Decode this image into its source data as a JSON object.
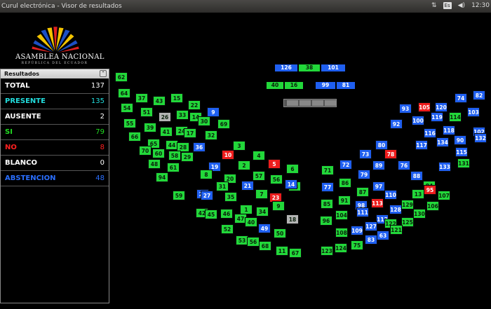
{
  "window": {
    "title": "Curul electrónica - Visor de resultados",
    "keyboard_layout": "Es",
    "clock": "12:30"
  },
  "logo": {
    "name": "ASAMBLEA NACIONAL",
    "subtitle": "REPÚBLICA DEL ECUADOR"
  },
  "panel": {
    "title": "Resultados",
    "rows": [
      {
        "label": "TOTAL",
        "value": "137",
        "color": "#ffffff"
      },
      {
        "label": "PRESENTE",
        "value": "135",
        "color": "#22dede"
      },
      {
        "label": "AUSENTE",
        "value": "2",
        "color": "#ffffff"
      },
      {
        "label": "SI",
        "value": "79",
        "color": "#22dd22"
      },
      {
        "label": "NO",
        "value": "8",
        "color": "#ff2020"
      },
      {
        "label": "BLANCO",
        "value": "0",
        "color": "#ffffff"
      },
      {
        "label": "ABSTENCION",
        "value": "48",
        "color": "#2a6fff"
      }
    ]
  },
  "colors": {
    "green": "#22d83a",
    "blue": "#1f5ff0",
    "red": "#ee1c1c",
    "gray": "#b4b4b4",
    "green_text": "#0a1f0a",
    "white_text": "#ffffff"
  },
  "legend_bars": [
    {
      "label": "126",
      "color": "blue"
    },
    {
      "label": "38",
      "color": "green"
    },
    {
      "label": "101",
      "color": "blue"
    },
    {
      "label": "40",
      "color": "green"
    },
    {
      "label": "16",
      "color": "green"
    },
    {
      "label": "99",
      "color": "blue"
    },
    {
      "label": "81",
      "color": "blue"
    }
  ],
  "seats": [
    [
      "62",
      "green"
    ],
    [
      "64",
      "green"
    ],
    [
      "37",
      "green"
    ],
    [
      "43",
      "green"
    ],
    [
      "15",
      "green"
    ],
    [
      "22",
      "green"
    ],
    [
      "9",
      "blue"
    ],
    [
      "54",
      "green"
    ],
    [
      "51",
      "green"
    ],
    [
      "26",
      "gray"
    ],
    [
      "33",
      "green"
    ],
    [
      "14",
      "green"
    ],
    [
      "30",
      "green"
    ],
    [
      "69",
      "green"
    ],
    [
      "55",
      "green"
    ],
    [
      "39",
      "green"
    ],
    [
      "41",
      "green"
    ],
    [
      "24",
      "green"
    ],
    [
      "17",
      "green"
    ],
    [
      "32",
      "green"
    ],
    [
      "66",
      "green"
    ],
    [
      "65",
      "green"
    ],
    [
      "44",
      "green"
    ],
    [
      "28",
      "green"
    ],
    [
      "36",
      "blue"
    ],
    [
      "70",
      "green"
    ],
    [
      "60",
      "green"
    ],
    [
      "58",
      "green"
    ],
    [
      "29",
      "green"
    ],
    [
      "48",
      "green"
    ],
    [
      "61",
      "green"
    ],
    [
      "3",
      "green"
    ],
    [
      "94",
      "green"
    ],
    [
      "10",
      "red"
    ],
    [
      "4",
      "green"
    ],
    [
      "5",
      "red"
    ],
    [
      "6",
      "green"
    ],
    [
      "19",
      "blue"
    ],
    [
      "2",
      "green"
    ],
    [
      "57",
      "green"
    ],
    [
      "56",
      "green"
    ],
    [
      "13",
      "green"
    ],
    [
      "8",
      "green"
    ],
    [
      "20",
      "green"
    ],
    [
      "21",
      "blue"
    ],
    [
      "7",
      "green"
    ],
    [
      "23",
      "red"
    ],
    [
      "14",
      "blue"
    ],
    [
      "59",
      "green"
    ],
    [
      "25",
      "blue"
    ],
    [
      "27",
      "blue"
    ],
    [
      "31",
      "green"
    ],
    [
      "35",
      "green"
    ],
    [
      "1",
      "green"
    ],
    [
      "34",
      "green"
    ],
    [
      "9",
      "green"
    ],
    [
      "18",
      "gray"
    ],
    [
      "42",
      "green"
    ],
    [
      "45",
      "green"
    ],
    [
      "46",
      "green"
    ],
    [
      "47",
      "green"
    ],
    [
      "40",
      "green"
    ],
    [
      "49",
      "blue"
    ],
    [
      "50",
      "green"
    ],
    [
      "52",
      "green"
    ],
    [
      "53",
      "green"
    ],
    [
      "56",
      "green"
    ],
    [
      "68",
      "green"
    ],
    [
      "11",
      "green"
    ],
    [
      "67",
      "green"
    ],
    [
      "71",
      "green"
    ],
    [
      "72",
      "blue"
    ],
    [
      "73",
      "blue"
    ],
    [
      "80",
      "blue"
    ],
    [
      "78",
      "red"
    ],
    [
      "79",
      "blue"
    ],
    [
      "89",
      "blue"
    ],
    [
      "76",
      "blue"
    ],
    [
      "77",
      "blue"
    ],
    [
      "86",
      "green"
    ],
    [
      "87",
      "green"
    ],
    [
      "97",
      "blue"
    ],
    [
      "88",
      "blue"
    ],
    [
      "84",
      "green"
    ],
    [
      "85",
      "green"
    ],
    [
      "91",
      "green"
    ],
    [
      "98",
      "blue"
    ],
    [
      "113",
      "red"
    ],
    [
      "110",
      "blue"
    ],
    [
      "13",
      "green"
    ],
    [
      "95",
      "red"
    ],
    [
      "96",
      "green"
    ],
    [
      "104",
      "green"
    ],
    [
      "111",
      "blue"
    ],
    [
      "112",
      "blue"
    ],
    [
      "128",
      "blue"
    ],
    [
      "129",
      "green"
    ],
    [
      "130",
      "green"
    ],
    [
      "106",
      "green"
    ],
    [
      "107",
      "green"
    ],
    [
      "108",
      "green"
    ],
    [
      "109",
      "blue"
    ],
    [
      "127",
      "blue"
    ],
    [
      "122",
      "green"
    ],
    [
      "125",
      "green"
    ],
    [
      "121",
      "green"
    ],
    [
      "63",
      "blue"
    ],
    [
      "123",
      "green"
    ],
    [
      "124",
      "green"
    ],
    [
      "75",
      "green"
    ],
    [
      "83",
      "blue"
    ],
    [
      "93",
      "blue"
    ],
    [
      "105",
      "red"
    ],
    [
      "120",
      "blue"
    ],
    [
      "74",
      "blue"
    ],
    [
      "82",
      "blue"
    ],
    [
      "92",
      "blue"
    ],
    [
      "100",
      "blue"
    ],
    [
      "119",
      "blue"
    ],
    [
      "114",
      "green"
    ],
    [
      "103",
      "blue"
    ],
    [
      "116",
      "blue"
    ],
    [
      "118",
      "blue"
    ],
    [
      "90",
      "blue"
    ],
    [
      "102",
      "blue"
    ],
    [
      "117",
      "blue"
    ],
    [
      "134",
      "blue"
    ],
    [
      "115",
      "blue"
    ],
    [
      "132",
      "blue"
    ],
    [
      "133",
      "blue"
    ],
    [
      "131",
      "green"
    ]
  ]
}
